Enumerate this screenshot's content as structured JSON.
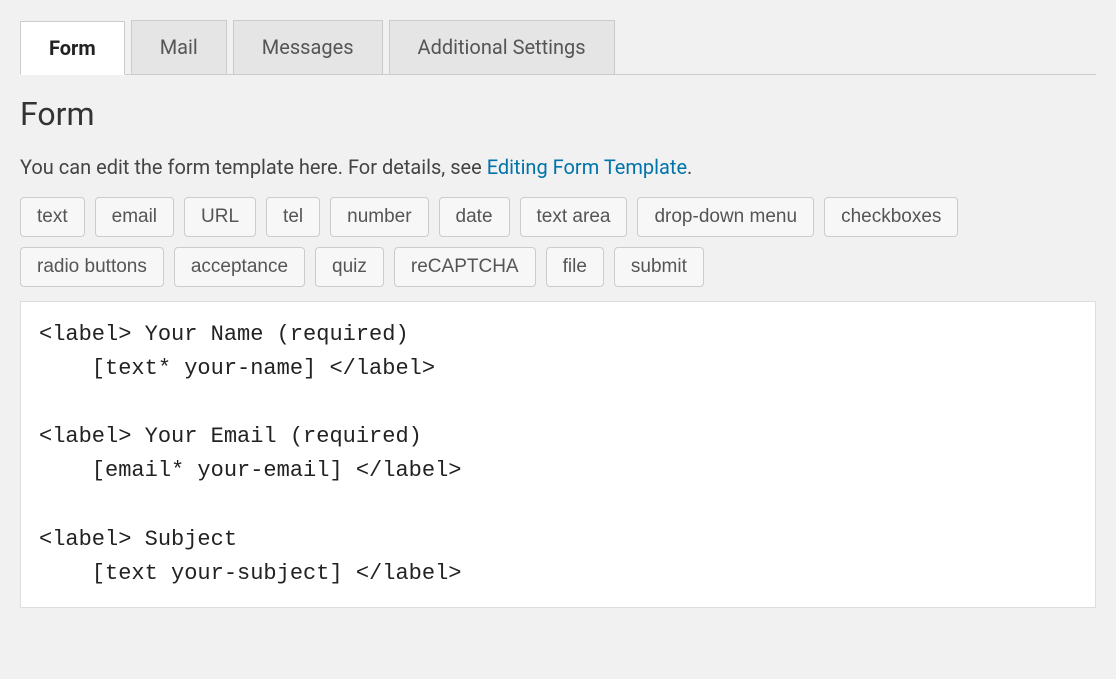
{
  "tabs": [
    {
      "label": "Form",
      "active": true
    },
    {
      "label": "Mail",
      "active": false
    },
    {
      "label": "Messages",
      "active": false
    },
    {
      "label": "Additional Settings",
      "active": false
    }
  ],
  "section": {
    "title": "Form",
    "description_prefix": "You can edit the form template here. For details, see ",
    "description_link": "Editing Form Template",
    "description_suffix": "."
  },
  "tag_buttons": [
    "text",
    "email",
    "URL",
    "tel",
    "number",
    "date",
    "text area",
    "drop-down menu",
    "checkboxes",
    "radio buttons",
    "acceptance",
    "quiz",
    "reCAPTCHA",
    "file",
    "submit"
  ],
  "editor_content": "<label> Your Name (required)\n    [text* your-name] </label>\n\n<label> Your Email (required)\n    [email* your-email] </label>\n\n<label> Subject\n    [text your-subject] </label>"
}
